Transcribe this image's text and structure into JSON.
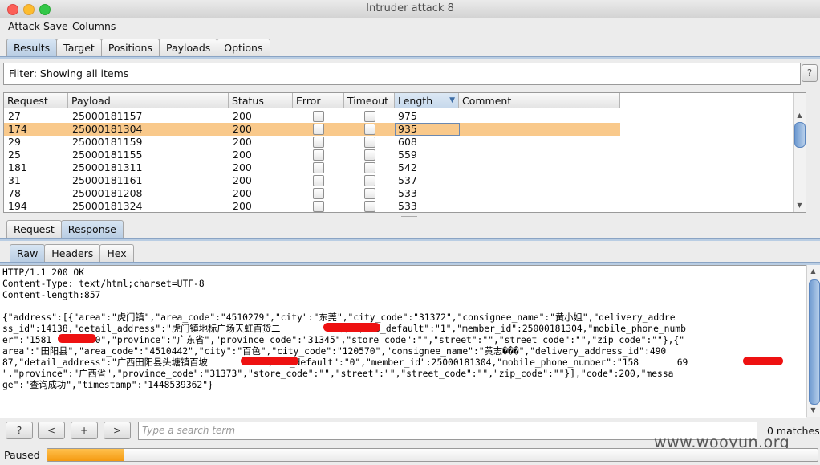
{
  "window": {
    "title": "Intruder attack 8"
  },
  "menu": [
    "Attack",
    "Save",
    "Columns"
  ],
  "main_tabs": [
    {
      "label": "Results",
      "active": true
    },
    {
      "label": "Target",
      "active": false
    },
    {
      "label": "Positions",
      "active": false
    },
    {
      "label": "Payloads",
      "active": false
    },
    {
      "label": "Options",
      "active": false
    }
  ],
  "filter": {
    "text": "Filter: Showing all items",
    "help_label": "?"
  },
  "results_table": {
    "columns": [
      "Request",
      "Payload",
      "Status",
      "Error",
      "Timeout",
      "Length",
      "Comment"
    ],
    "sorted_column": "Length",
    "rows": [
      {
        "request": "27",
        "payload": "25000181157",
        "status": "200",
        "error": false,
        "timeout": false,
        "length": "975",
        "comment": "",
        "selected": false
      },
      {
        "request": "174",
        "payload": "25000181304",
        "status": "200",
        "error": false,
        "timeout": false,
        "length": "935",
        "comment": "",
        "selected": true
      },
      {
        "request": "29",
        "payload": "25000181159",
        "status": "200",
        "error": false,
        "timeout": false,
        "length": "608",
        "comment": "",
        "selected": false
      },
      {
        "request": "25",
        "payload": "25000181155",
        "status": "200",
        "error": false,
        "timeout": false,
        "length": "559",
        "comment": "",
        "selected": false
      },
      {
        "request": "181",
        "payload": "25000181311",
        "status": "200",
        "error": false,
        "timeout": false,
        "length": "542",
        "comment": "",
        "selected": false
      },
      {
        "request": "31",
        "payload": "25000181161",
        "status": "200",
        "error": false,
        "timeout": false,
        "length": "537",
        "comment": "",
        "selected": false
      },
      {
        "request": "78",
        "payload": "25000181208",
        "status": "200",
        "error": false,
        "timeout": false,
        "length": "533",
        "comment": "",
        "selected": false
      },
      {
        "request": "194",
        "payload": "25000181324",
        "status": "200",
        "error": false,
        "timeout": false,
        "length": "533",
        "comment": "",
        "selected": false
      }
    ]
  },
  "message_tabs": [
    {
      "label": "Request",
      "active": false
    },
    {
      "label": "Response",
      "active": true
    }
  ],
  "view_tabs": [
    {
      "label": "Raw",
      "active": true
    },
    {
      "label": "Headers",
      "active": false
    },
    {
      "label": "Hex",
      "active": false
    }
  ],
  "response": {
    "lines": [
      "HTTP/1.1 200 OK",
      "Content-Type: text/html;charset=UTF-8",
      "Content-length:857",
      "",
      "{\"address\":[{\"area\":\"虎门镇\",\"area_code\":\"4510279\",\"city\":\"东莞\",\"city_code\":\"31372\",\"consignee_name\":\"黄小姐\",\"delivery_addre",
      "ss_id\":14138,\"detail_address\":\"虎门镇地标广场天虹百货二          专柜\",\"is_default\":\"1\",\"member_id\":25000181304,\"mobile_phone_numb",
      "er\":\"1581       30\",\"province\":\"广东省\",\"province_code\":\"31345\",\"store_code\":\"\",\"street\":\"\",\"street_code\":\"\",\"zip_code\":\"\"},{\"",
      "area\":\"田阳县\",\"area_code\":\"4510442\",\"city\":\"百色\",\"city_code\":\"120570\",\"consignee_name\":\"黄志���\",\"delivery_address_id\":490",
      "87,\"detail_address\":\"广西田阳县头塘镇百坡          \",\"is_default\":\"0\",\"member_id\":25000181304,\"mobile_phone_number\":\"158       69",
      "\",\"province\":\"广西省\",\"province_code\":\"31373\",\"store_code\":\"\",\"street\":\"\",\"street_code\":\"\",\"zip_code\":\"\"}],\"code\":200,\"messa",
      "ge\":\"查询成功\",\"timestamp\":\"1448539362\"}"
    ]
  },
  "search_bar": {
    "help_label": "?",
    "prev_label": "<",
    "add_label": "+",
    "next_label": ">",
    "placeholder": "Type a search term",
    "matches": "0 matches"
  },
  "watermark": "www.wooyun.org",
  "status": {
    "label": "Paused",
    "progress": 0.1
  },
  "colors": {
    "selected_row": "#f9c98b",
    "redaction": "#ee1111",
    "progress": "#f59a11",
    "active_tab": "#b9cde3"
  }
}
